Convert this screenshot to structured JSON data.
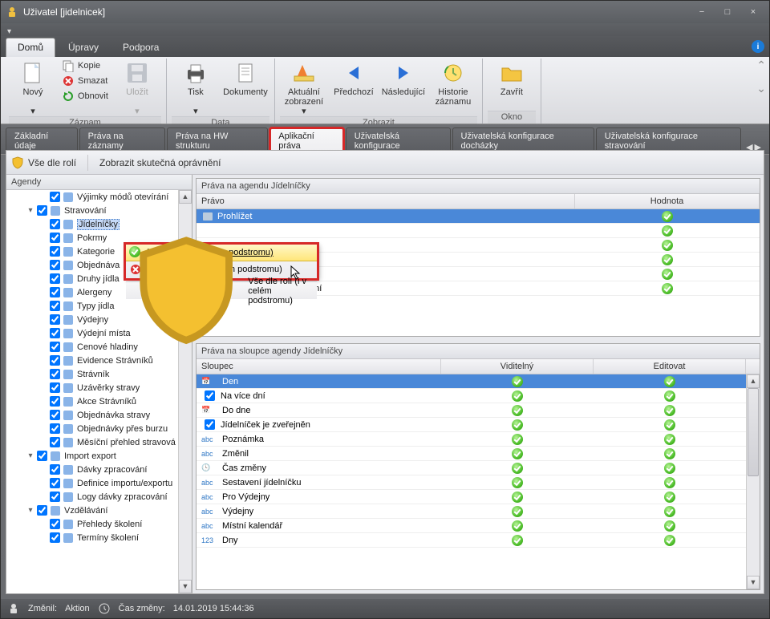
{
  "window": {
    "title": "Uživatel [jidelnicek]"
  },
  "sysbuttons": {
    "min": "−",
    "max": "□",
    "close": "×"
  },
  "ribbon": {
    "tabs": [
      "Domů",
      "Úpravy",
      "Podpora"
    ],
    "active_tab": 0,
    "groups": {
      "zaznam": {
        "label": "Záznam",
        "novy": "Nový",
        "kopie": "Kopie",
        "smazat": "Smazat",
        "obnovit": "Obnovit",
        "ulozit": "Uložit"
      },
      "data": {
        "label": "Data",
        "tisk": "Tisk",
        "dokumenty": "Dokumenty"
      },
      "zobrazit": {
        "label": "Zobrazit",
        "aktualni": "Aktuální zobrazení ▾",
        "predchozi": "Předchozí",
        "nasledujici": "Následující",
        "historie": "Historie záznamu"
      },
      "okno": {
        "label": "Okno",
        "zavrit": "Zavřít"
      }
    }
  },
  "file_tabs": [
    "Základní údaje",
    "Práva na záznamy",
    "Práva na HW strukturu",
    "Aplikační práva",
    "Uživatelská konfigurace",
    "Uživatelská konfigurace docházky",
    "Uživatelská konfigurace stravování"
  ],
  "file_tab_active": 3,
  "toolbar": {
    "vse_dle_roli": "Vše dle rolí",
    "zobrazit_skutecna": "Zobrazit skutečná oprávnění"
  },
  "agendy": {
    "header": "Agendy",
    "tree": [
      {
        "depth": 2,
        "exp": "",
        "ck": true,
        "icon": "gear",
        "label": "Výjimky módů otevírání"
      },
      {
        "depth": 1,
        "exp": "-",
        "ck": true,
        "icon": "apple-red",
        "label": "Stravování"
      },
      {
        "depth": 2,
        "exp": "",
        "ck": true,
        "icon": "calendar",
        "label": "Jídelníčky",
        "selected": true
      },
      {
        "depth": 2,
        "exp": "",
        "ck": true,
        "icon": "apple",
        "label": "Pokrmy"
      },
      {
        "depth": 2,
        "exp": "",
        "ck": true,
        "icon": "folder",
        "label": "Kategorie"
      },
      {
        "depth": 2,
        "exp": "",
        "ck": true,
        "icon": "note",
        "label": "Objednáva"
      },
      {
        "depth": 2,
        "exp": "",
        "ck": true,
        "icon": "list",
        "label": "Druhy jídla"
      },
      {
        "depth": 2,
        "exp": "",
        "ck": true,
        "icon": "warn",
        "label": "Alergeny"
      },
      {
        "depth": 2,
        "exp": "",
        "ck": true,
        "icon": "list",
        "label": "Typy jídla"
      },
      {
        "depth": 2,
        "exp": "",
        "ck": true,
        "icon": "house",
        "label": "Výdejny"
      },
      {
        "depth": 2,
        "exp": "",
        "ck": true,
        "icon": "house",
        "label": "Výdejní místa"
      },
      {
        "depth": 2,
        "exp": "",
        "ck": true,
        "icon": "money",
        "label": "Cenové hladiny"
      },
      {
        "depth": 2,
        "exp": "",
        "ck": true,
        "icon": "people",
        "label": "Evidence Strávníků"
      },
      {
        "depth": 2,
        "exp": "",
        "ck": true,
        "icon": "person",
        "label": "Strávník"
      },
      {
        "depth": 2,
        "exp": "",
        "ck": true,
        "icon": "lock",
        "label": "Uzávěrky stravy"
      },
      {
        "depth": 2,
        "exp": "",
        "ck": true,
        "icon": "ticket",
        "label": "Akce Strávníků"
      },
      {
        "depth": 2,
        "exp": "",
        "ck": true,
        "icon": "note",
        "label": "Objednávka stravy"
      },
      {
        "depth": 2,
        "exp": "",
        "ck": true,
        "icon": "note",
        "label": "Objednávky přes burzu"
      },
      {
        "depth": 2,
        "exp": "",
        "ck": true,
        "icon": "report",
        "label": "Měsíční přehled stravová"
      },
      {
        "depth": 1,
        "exp": "-",
        "ck": true,
        "icon": "box",
        "label": "Import export"
      },
      {
        "depth": 2,
        "exp": "",
        "ck": true,
        "icon": "gear2",
        "label": "Dávky zpracování"
      },
      {
        "depth": 2,
        "exp": "",
        "ck": true,
        "icon": "doc",
        "label": "Definice importu/exportu"
      },
      {
        "depth": 2,
        "exp": "",
        "ck": true,
        "icon": "log",
        "label": "Logy dávky zpracování"
      },
      {
        "depth": 1,
        "exp": "-",
        "ck": true,
        "icon": "grad",
        "label": "Vzdělávání"
      },
      {
        "depth": 2,
        "exp": "",
        "ck": true,
        "icon": "report",
        "label": "Přehledy školení"
      },
      {
        "depth": 2,
        "exp": "",
        "ck": true,
        "icon": "cal",
        "label": "Termíny školení"
      }
    ]
  },
  "grid1": {
    "title": "Práva na agendu Jídelníčky",
    "head": {
      "pravo": "Právo",
      "hodnota": "Hodnota"
    },
    "rows": [
      {
        "icon": "eye",
        "label": "Prohlížet",
        "sel": true
      },
      {
        "icon": "",
        "label": ""
      },
      {
        "icon": "",
        "label": ""
      },
      {
        "icon": "",
        "label": ""
      },
      {
        "icon": "print",
        "label": "Tisk"
      },
      {
        "icon": "edit",
        "label": "Editovat veřejná zobrazení"
      }
    ]
  },
  "grid2": {
    "title": "Práva na sloupce agendy Jídelníčky",
    "head": {
      "sloupec": "Sloupec",
      "viditelny": "Viditelný",
      "editovat": "Editovat"
    },
    "rows": [
      {
        "type": "cal",
        "label": "Den",
        "sel": true
      },
      {
        "type": "ck",
        "label": "Na více dní"
      },
      {
        "type": "cal",
        "label": "Do dne"
      },
      {
        "type": "ck",
        "label": "Jídelníček je zveřejněn"
      },
      {
        "type": "abc",
        "label": "Poznámka"
      },
      {
        "type": "abc",
        "label": "Změnil"
      },
      {
        "type": "clk",
        "label": "Čas změny"
      },
      {
        "type": "abc",
        "label": "Sestavení jídelníčku"
      },
      {
        "type": "abc",
        "label": "Pro Výdejny"
      },
      {
        "type": "abc",
        "label": "Výdejny"
      },
      {
        "type": "abc",
        "label": "Místní kalendář"
      },
      {
        "type": "123",
        "label": "Dny"
      }
    ]
  },
  "context_menu": {
    "add": "Přidat vše (i v celém podstromu)",
    "remove": "Odebrat vše (i v celém podstromu)",
    "roles": "Vše dle rolí (i v celém podstromu)"
  },
  "cursor_icon": "mouse-pointer",
  "statusbar": {
    "zmenil_label": "Změnil:",
    "zmenil_value": "Aktion",
    "cas_label": "Čas změny:",
    "cas_value": "14.01.2019 15:44:36"
  }
}
